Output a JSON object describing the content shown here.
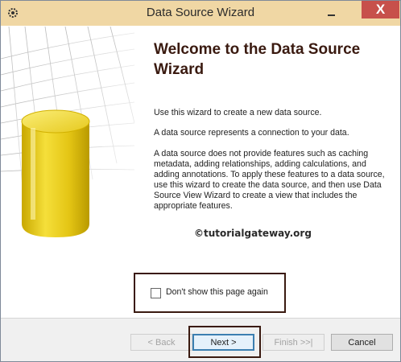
{
  "window": {
    "title": "Data Source Wizard",
    "close_glyph": "X",
    "accent_color": "#f0d7a4",
    "close_color": "#c7504b"
  },
  "content": {
    "heading": "Welcome to the Data Source Wizard",
    "paragraphs": [
      "Use this wizard to create a new data source.",
      "A data source represents a connection to your data.",
      "A data source does not provide features such as caching metadata, adding relationships, adding calculations, and adding annotations. To apply these features to a data source, use this wizard to create the data source, and then use Data Source View Wizard to create a view that includes the appropriate features."
    ],
    "watermark": "©tutorialgateway.org",
    "dont_show_label": "Don't show this page again",
    "dont_show_checked": false
  },
  "buttons": {
    "back": "< Back",
    "next": "Next >",
    "finish": "Finish >>|",
    "cancel": "Cancel"
  },
  "icons": {
    "app": "gear-icon",
    "minimize": "minimize-icon",
    "close": "close-icon",
    "banner": "database-cylinder-icon"
  }
}
